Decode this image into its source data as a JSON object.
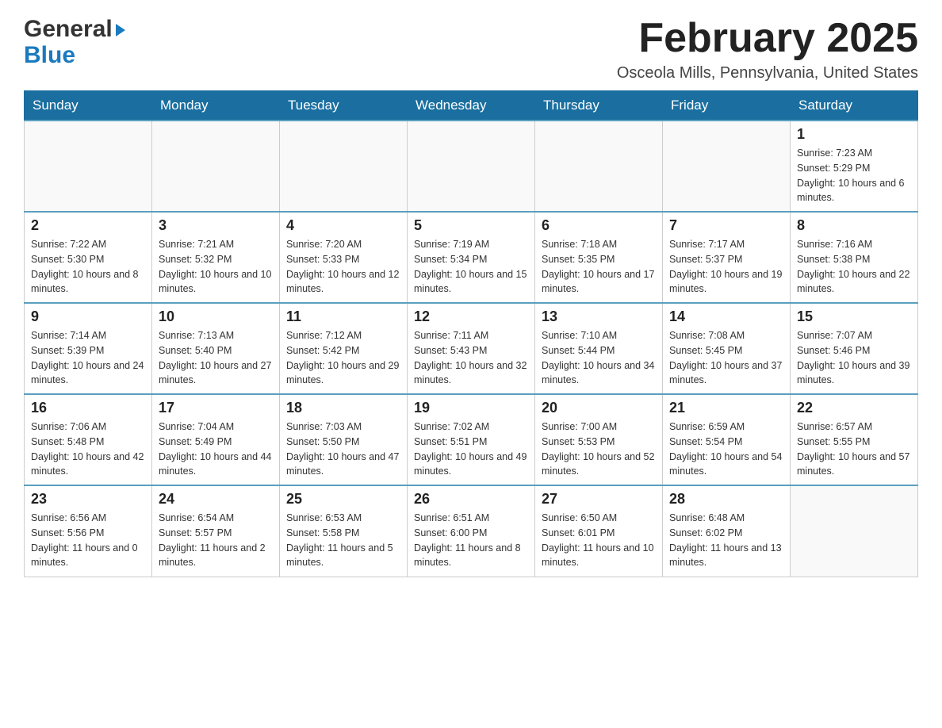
{
  "header": {
    "logo_general": "General",
    "logo_blue": "Blue",
    "month_title": "February 2025",
    "location": "Osceola Mills, Pennsylvania, United States"
  },
  "days_of_week": [
    "Sunday",
    "Monday",
    "Tuesday",
    "Wednesday",
    "Thursday",
    "Friday",
    "Saturday"
  ],
  "weeks": [
    {
      "days": [
        {
          "number": "",
          "info": ""
        },
        {
          "number": "",
          "info": ""
        },
        {
          "number": "",
          "info": ""
        },
        {
          "number": "",
          "info": ""
        },
        {
          "number": "",
          "info": ""
        },
        {
          "number": "",
          "info": ""
        },
        {
          "number": "1",
          "info": "Sunrise: 7:23 AM\nSunset: 5:29 PM\nDaylight: 10 hours and 6 minutes."
        }
      ]
    },
    {
      "days": [
        {
          "number": "2",
          "info": "Sunrise: 7:22 AM\nSunset: 5:30 PM\nDaylight: 10 hours and 8 minutes."
        },
        {
          "number": "3",
          "info": "Sunrise: 7:21 AM\nSunset: 5:32 PM\nDaylight: 10 hours and 10 minutes."
        },
        {
          "number": "4",
          "info": "Sunrise: 7:20 AM\nSunset: 5:33 PM\nDaylight: 10 hours and 12 minutes."
        },
        {
          "number": "5",
          "info": "Sunrise: 7:19 AM\nSunset: 5:34 PM\nDaylight: 10 hours and 15 minutes."
        },
        {
          "number": "6",
          "info": "Sunrise: 7:18 AM\nSunset: 5:35 PM\nDaylight: 10 hours and 17 minutes."
        },
        {
          "number": "7",
          "info": "Sunrise: 7:17 AM\nSunset: 5:37 PM\nDaylight: 10 hours and 19 minutes."
        },
        {
          "number": "8",
          "info": "Sunrise: 7:16 AM\nSunset: 5:38 PM\nDaylight: 10 hours and 22 minutes."
        }
      ]
    },
    {
      "days": [
        {
          "number": "9",
          "info": "Sunrise: 7:14 AM\nSunset: 5:39 PM\nDaylight: 10 hours and 24 minutes."
        },
        {
          "number": "10",
          "info": "Sunrise: 7:13 AM\nSunset: 5:40 PM\nDaylight: 10 hours and 27 minutes."
        },
        {
          "number": "11",
          "info": "Sunrise: 7:12 AM\nSunset: 5:42 PM\nDaylight: 10 hours and 29 minutes."
        },
        {
          "number": "12",
          "info": "Sunrise: 7:11 AM\nSunset: 5:43 PM\nDaylight: 10 hours and 32 minutes."
        },
        {
          "number": "13",
          "info": "Sunrise: 7:10 AM\nSunset: 5:44 PM\nDaylight: 10 hours and 34 minutes."
        },
        {
          "number": "14",
          "info": "Sunrise: 7:08 AM\nSunset: 5:45 PM\nDaylight: 10 hours and 37 minutes."
        },
        {
          "number": "15",
          "info": "Sunrise: 7:07 AM\nSunset: 5:46 PM\nDaylight: 10 hours and 39 minutes."
        }
      ]
    },
    {
      "days": [
        {
          "number": "16",
          "info": "Sunrise: 7:06 AM\nSunset: 5:48 PM\nDaylight: 10 hours and 42 minutes."
        },
        {
          "number": "17",
          "info": "Sunrise: 7:04 AM\nSunset: 5:49 PM\nDaylight: 10 hours and 44 minutes."
        },
        {
          "number": "18",
          "info": "Sunrise: 7:03 AM\nSunset: 5:50 PM\nDaylight: 10 hours and 47 minutes."
        },
        {
          "number": "19",
          "info": "Sunrise: 7:02 AM\nSunset: 5:51 PM\nDaylight: 10 hours and 49 minutes."
        },
        {
          "number": "20",
          "info": "Sunrise: 7:00 AM\nSunset: 5:53 PM\nDaylight: 10 hours and 52 minutes."
        },
        {
          "number": "21",
          "info": "Sunrise: 6:59 AM\nSunset: 5:54 PM\nDaylight: 10 hours and 54 minutes."
        },
        {
          "number": "22",
          "info": "Sunrise: 6:57 AM\nSunset: 5:55 PM\nDaylight: 10 hours and 57 minutes."
        }
      ]
    },
    {
      "days": [
        {
          "number": "23",
          "info": "Sunrise: 6:56 AM\nSunset: 5:56 PM\nDaylight: 11 hours and 0 minutes."
        },
        {
          "number": "24",
          "info": "Sunrise: 6:54 AM\nSunset: 5:57 PM\nDaylight: 11 hours and 2 minutes."
        },
        {
          "number": "25",
          "info": "Sunrise: 6:53 AM\nSunset: 5:58 PM\nDaylight: 11 hours and 5 minutes."
        },
        {
          "number": "26",
          "info": "Sunrise: 6:51 AM\nSunset: 6:00 PM\nDaylight: 11 hours and 8 minutes."
        },
        {
          "number": "27",
          "info": "Sunrise: 6:50 AM\nSunset: 6:01 PM\nDaylight: 11 hours and 10 minutes."
        },
        {
          "number": "28",
          "info": "Sunrise: 6:48 AM\nSunset: 6:02 PM\nDaylight: 11 hours and 13 minutes."
        },
        {
          "number": "",
          "info": ""
        }
      ]
    }
  ]
}
